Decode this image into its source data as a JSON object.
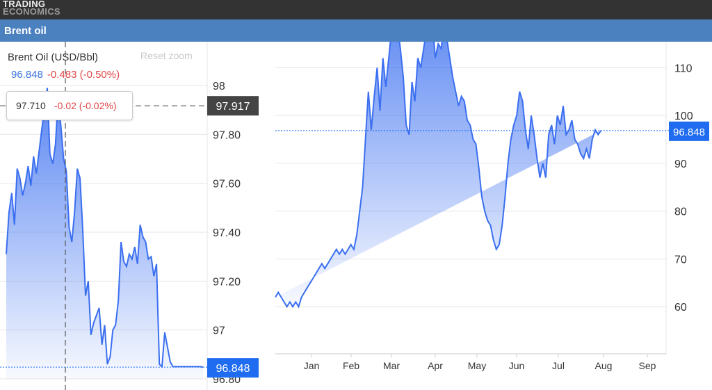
{
  "header": {
    "logo_line1": "TRADING",
    "logo_line2": "ECONOMICS",
    "title": "Brent oil"
  },
  "left_chart": {
    "instrument": "Brent Oil (USD/Bbl)",
    "last_price": "96.848",
    "change": "-0.483 (-0.50%)",
    "reset_zoom_label": "Reset zoom",
    "tooltip_price": "97.710",
    "tooltip_change": "-0.02 (-0.02%)",
    "crosshair_label": "97.917",
    "last_label": "96.848"
  },
  "right_chart": {
    "last_label": "96.848"
  },
  "colors": {
    "line": "#3b6ff0",
    "last_label_bg": "#1f6cf0",
    "crosshair_label_bg": "#444444",
    "change_negative": "#e04848"
  },
  "chart_data": [
    {
      "type": "area",
      "name": "intraday",
      "x": [
        0,
        0.33,
        0.67,
        1.0,
        1.33,
        1.67,
        2.0,
        2.33,
        2.67,
        3.0,
        3.33,
        3.67,
        4.0,
        4.33,
        4.67,
        5.0,
        5.33,
        5.67,
        6.0,
        6.33,
        6.67,
        7.0,
        7.33,
        7.67,
        8.0,
        8.33,
        8.67,
        9.0,
        9.33,
        9.67,
        10.0,
        10.33,
        10.67,
        11.0,
        11.33,
        11.67,
        12.0,
        12.33,
        12.67,
        13.0,
        13.33,
        13.67,
        14.0,
        14.33,
        14.67,
        15.0,
        15.33,
        15.67,
        16.0,
        16.33,
        16.67,
        17.0,
        17.33,
        17.67,
        18.0,
        18.33,
        18.67,
        19.0,
        19.33,
        19.67,
        20.0,
        20.33,
        20.67,
        21.0,
        21.33,
        21.67,
        22.0,
        22.33,
        22.67,
        23.0,
        23.33,
        23.67,
        24.0
      ],
      "values": [
        97.31,
        97.48,
        97.56,
        97.43,
        97.66,
        97.62,
        97.55,
        97.6,
        97.67,
        97.59,
        97.71,
        97.64,
        97.73,
        97.82,
        97.91,
        97.99,
        97.72,
        97.68,
        97.76,
        97.95,
        97.83,
        97.7,
        97.65,
        97.42,
        97.36,
        97.48,
        97.66,
        97.62,
        97.41,
        97.14,
        97.2,
        96.98,
        97.03,
        97.06,
        97.09,
        96.94,
        97.02,
        96.86,
        96.89,
        97.0,
        97.02,
        97.12,
        97.36,
        97.28,
        97.26,
        97.31,
        97.29,
        97.34,
        97.27,
        97.43,
        97.38,
        97.36,
        97.29,
        97.3,
        97.22,
        97.27,
        96.86,
        96.85,
        96.99,
        96.93,
        96.87,
        96.85,
        96.85,
        96.85,
        96.85,
        96.85,
        96.85,
        96.85,
        96.85,
        96.85,
        96.85,
        96.85,
        96.848
      ],
      "ylim": [
        96.8,
        98
      ],
      "yticks": [
        "98",
        "97.80",
        "97.60",
        "97.40",
        "97.20",
        "97",
        "96.80"
      ],
      "crosshair_value": 97.917
    },
    {
      "type": "area",
      "name": "year-to-date",
      "categories": [
        "Jan",
        "Feb",
        "Mar",
        "Apr",
        "May",
        "Jun",
        "Jul",
        "Aug",
        "Sep"
      ],
      "x": [
        0,
        2,
        4,
        6,
        8,
        10,
        12,
        14,
        16,
        18,
        20,
        22,
        24,
        26,
        28,
        30,
        32,
        34,
        36,
        38,
        40,
        42,
        44,
        46,
        48,
        50,
        52,
        54,
        56,
        58,
        60,
        62,
        64,
        66,
        68,
        70,
        72,
        74,
        76,
        78,
        80,
        82,
        84,
        86,
        88,
        90,
        92,
        94,
        96,
        98,
        100,
        102,
        104,
        106,
        108,
        110,
        112,
        114,
        116,
        118,
        120,
        122,
        124,
        126,
        128,
        130,
        132,
        134,
        136,
        138,
        140,
        142,
        144,
        146,
        148,
        150,
        152,
        154,
        156,
        158,
        160,
        162,
        164,
        166,
        168,
        170,
        172,
        174,
        176,
        178,
        180,
        182,
        184,
        186,
        188,
        190,
        192,
        194,
        196,
        198,
        200,
        202,
        204,
        206,
        208,
        210,
        212,
        214,
        216,
        218,
        220,
        222,
        224,
        226,
        228,
        230,
        232,
        234,
        236,
        238,
        240,
        242,
        244,
        246,
        248,
        250,
        252,
        254,
        256,
        258,
        260,
        262,
        264
      ],
      "values": [
        62,
        63,
        62,
        61,
        60,
        61,
        60,
        61,
        60,
        62,
        63,
        64,
        65,
        66,
        67,
        68,
        69,
        68,
        69,
        70,
        71,
        72,
        71,
        72,
        71,
        72,
        73,
        72,
        75,
        80,
        85,
        95,
        105,
        97,
        104,
        110,
        101,
        112,
        106,
        112,
        118,
        124,
        119,
        114,
        108,
        98,
        96,
        107,
        103,
        112,
        110,
        114,
        118,
        122,
        120,
        112,
        115,
        114,
        118,
        116,
        112,
        108,
        105,
        102,
        104,
        103,
        99,
        98,
        95,
        94,
        89,
        83,
        80,
        78,
        77,
        74,
        72,
        73,
        77,
        83,
        90,
        95,
        98,
        100,
        105,
        103,
        97,
        93,
        100,
        96,
        91,
        87,
        90,
        87,
        96,
        98,
        94,
        100,
        98,
        102,
        96,
        97,
        99,
        95,
        94,
        92,
        91,
        93,
        91,
        95,
        97,
        96,
        96.848
      ],
      "ylim": [
        50,
        115
      ],
      "yticks": [
        "110",
        "100",
        "90",
        "80",
        "70",
        "60"
      ]
    }
  ]
}
